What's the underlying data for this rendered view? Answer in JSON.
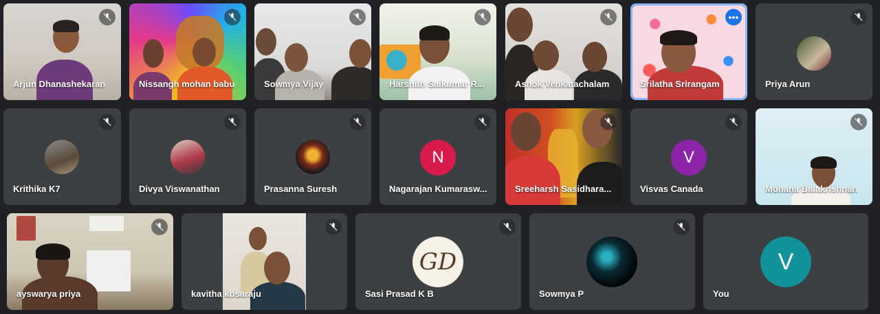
{
  "colors": {
    "background": "#202124",
    "tile": "#3c4043",
    "speaking_border": "#8ab4f8",
    "avatar_n": "#d81b4a",
    "avatar_v": "#8e24aa",
    "avatar_you": "#12939a"
  },
  "participants": [
    {
      "name": "Arjun Dhanashekaran",
      "muted": true,
      "video": true
    },
    {
      "name": "Nissangh mohan babu",
      "muted": true,
      "video": true
    },
    {
      "name": "Sowmya Vijay",
      "muted": true,
      "video": true
    },
    {
      "name": "Harshith Saikumar R...",
      "muted": true,
      "video": true
    },
    {
      "name": "Ashok Venkatachalam",
      "muted": true,
      "video": true
    },
    {
      "name": "Srilatha Srirangam",
      "muted": false,
      "video": true,
      "speaking": true,
      "menu_icon": "more-options-icon"
    },
    {
      "name": "Priya Arun",
      "muted": true,
      "video": false,
      "avatar": "photo"
    },
    {
      "name": "Krithika K7",
      "muted": true,
      "video": false,
      "avatar": "photo"
    },
    {
      "name": "Divya Viswanathan",
      "muted": true,
      "video": false,
      "avatar": "photo"
    },
    {
      "name": "Prasanna Suresh",
      "muted": true,
      "video": false,
      "avatar": "photo"
    },
    {
      "name": "Nagarajan Kumarasw...",
      "muted": true,
      "video": false,
      "avatar_letter": "N"
    },
    {
      "name": "Sreeharsh Sasidhara...",
      "muted": true,
      "video": true
    },
    {
      "name": "Visvas Canada",
      "muted": true,
      "video": false,
      "avatar_letter": "V"
    },
    {
      "name": "Mohana Balakrishnan",
      "muted": true,
      "video": true
    },
    {
      "name": "ayswarya priya",
      "muted": true,
      "video": true
    },
    {
      "name": "kavitha kosaraju",
      "muted": true,
      "video": true
    },
    {
      "name": "Sasi Prasad K B",
      "muted": true,
      "video": false,
      "avatar_logo": "GD"
    },
    {
      "name": "Sowmya P",
      "muted": true,
      "video": false,
      "avatar": "photo"
    },
    {
      "name": "You",
      "muted": true,
      "video": false,
      "avatar_letter": "V"
    }
  ]
}
